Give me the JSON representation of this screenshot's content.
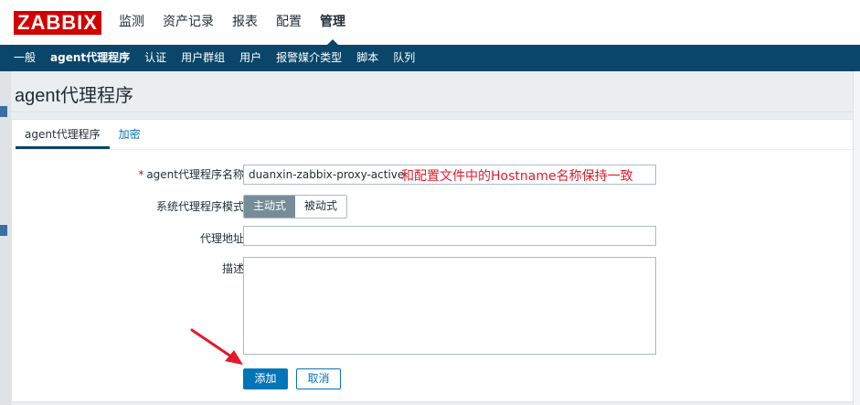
{
  "app": {
    "logo": "ZABBIX"
  },
  "main_menu": [
    {
      "label": "监测",
      "active": false
    },
    {
      "label": "资产记录",
      "active": false
    },
    {
      "label": "报表",
      "active": false
    },
    {
      "label": "配置",
      "active": false
    },
    {
      "label": "管理",
      "active": true
    }
  ],
  "sub_nav": [
    {
      "label": "一般",
      "active": false
    },
    {
      "label": "agent代理程序",
      "active": true
    },
    {
      "label": "认证",
      "active": false
    },
    {
      "label": "用户群组",
      "active": false
    },
    {
      "label": "用户",
      "active": false
    },
    {
      "label": "报警媒介类型",
      "active": false
    },
    {
      "label": "脚本",
      "active": false
    },
    {
      "label": "队列",
      "active": false
    }
  ],
  "page": {
    "title": "agent代理程序"
  },
  "tabs": [
    {
      "label": "agent代理程序",
      "active": true
    },
    {
      "label": "加密",
      "active": false
    }
  ],
  "form": {
    "required_mark": "*",
    "name_label": "agent代理程序名称",
    "name_value": "duanxin-zabbix-proxy-active",
    "annotation": "和配置文件中的Hostname名称保持一致",
    "mode_label": "系统代理程序模式",
    "mode_options": [
      {
        "label": "主动式",
        "selected": true
      },
      {
        "label": "被动式",
        "selected": false
      }
    ],
    "address_label": "代理地址",
    "address_value": "",
    "description_label": "描述",
    "description_value": ""
  },
  "buttons": {
    "add": "添加",
    "cancel": "取消"
  },
  "colors": {
    "brand_red": "#d40000",
    "nav_blue": "#0a466a",
    "accent_blue": "#0275b8",
    "segment_on": "#768d99",
    "annotation_red": "#e4192a"
  },
  "icons": {
    "arrow": "red-pointer-arrow-icon",
    "resize": "resize-grip-icon"
  }
}
